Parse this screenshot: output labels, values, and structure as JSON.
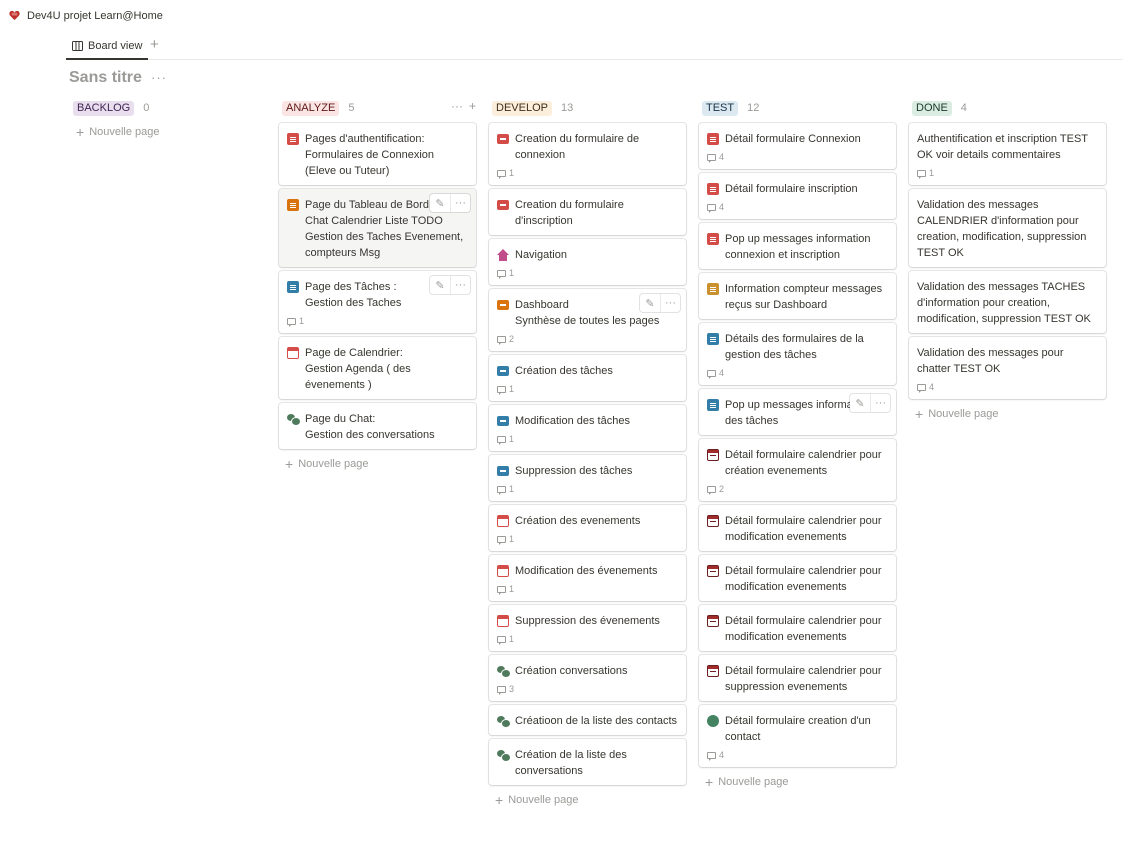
{
  "workspace": {
    "title": "Dev4U projet Learn@Home",
    "icon": "red-heart-icon"
  },
  "view": {
    "tab_label": "Board view",
    "add_icon": "plus-icon"
  },
  "database": {
    "title": "Sans titre",
    "more": "···"
  },
  "new_page_label": "Nouvelle page",
  "columns": [
    {
      "name": "BACKLOG",
      "count": "0",
      "bg": "#e8deee",
      "fg": "#412454",
      "cards": []
    },
    {
      "name": "ANALYZE",
      "count": "5",
      "bg": "#fbe4e4",
      "fg": "#5d1715",
      "actions": [
        "···",
        "+"
      ],
      "cards": [
        {
          "title": "Pages d'authentification:\nFormulaires de Connexion (Eleve ou Tuteur)",
          "icon": "ic-doc-red",
          "icon_name": "red-document-icon",
          "comments": ""
        },
        {
          "title": "Page du Tableau de Bord :\nChat Calendrier Liste TODO Gestion des Taches Evenement, compteurs Msg",
          "icon": "ic-doc-orange",
          "icon_name": "orange-document-icon",
          "comments": "",
          "hovered": true,
          "tools": true
        },
        {
          "title": "Page des Tâches :\nGestion des Taches",
          "icon": "ic-doc-blue",
          "icon_name": "blue-document-icon",
          "comments": "1",
          "tools": true
        },
        {
          "title": "Page de Calendrier:\nGestion Agenda ( des évenements )",
          "icon": "ic-cal-red",
          "icon_name": "calendar-icon",
          "comments": ""
        },
        {
          "title": "Page du Chat:\nGestion des conversations",
          "icon": "ic-chat-green",
          "icon_name": "chat-bubbles-icon",
          "comments": ""
        }
      ]
    },
    {
      "name": "DEVELOP",
      "count": "13",
      "bg": "#fbeeda",
      "fg": "#402c1b",
      "cards": [
        {
          "title": "Creation du formulaire de connexion",
          "icon": "ic-folder-red",
          "icon_name": "red-folder-icon",
          "comments": "1"
        },
        {
          "title": "Creation du formulaire d'inscription",
          "icon": "ic-folder-red",
          "icon_name": "red-folder-icon",
          "comments": ""
        },
        {
          "title": "Navigation",
          "icon": "ic-home",
          "icon_name": "home-icon",
          "comments": "1"
        },
        {
          "title": "Dashboard\nSynthèse de toutes les pages",
          "icon": "ic-folder-orange",
          "icon_name": "orange-folder-icon",
          "comments": "2",
          "tools": true
        },
        {
          "title": "Création des tâches",
          "icon": "ic-folder-blue",
          "icon_name": "blue-folder-icon",
          "comments": "1"
        },
        {
          "title": "Modification des tâches",
          "icon": "ic-folder-blue",
          "icon_name": "blue-folder-icon",
          "comments": "1"
        },
        {
          "title": "Suppression des tâches",
          "icon": "ic-folder-blue",
          "icon_name": "blue-folder-icon",
          "comments": "1"
        },
        {
          "title": "Création des evenements",
          "icon": "ic-cal-red",
          "icon_name": "calendar-icon",
          "comments": "1"
        },
        {
          "title": "Modification des évenements",
          "icon": "ic-cal-red",
          "icon_name": "calendar-icon",
          "comments": "1"
        },
        {
          "title": "Suppression des évenements",
          "icon": "ic-cal-red",
          "icon_name": "calendar-icon",
          "comments": "1"
        },
        {
          "title": "Création conversations",
          "icon": "ic-chat-green",
          "icon_name": "chat-bubbles-icon",
          "comments": "3"
        },
        {
          "title": "Créatioon de la liste des contacts",
          "icon": "ic-chat-green",
          "icon_name": "chat-bubbles-icon",
          "comments": ""
        },
        {
          "title": "Création de la liste des conversations",
          "icon": "ic-chat-green",
          "icon_name": "chat-bubbles-icon",
          "comments": ""
        }
      ]
    },
    {
      "name": "TEST",
      "count": "12",
      "bg": "#dde9f0",
      "fg": "#183347",
      "cards": [
        {
          "title": "Détail formulaire Connexion",
          "icon": "ic-doc-red",
          "icon_name": "red-document-icon",
          "comments": "4"
        },
        {
          "title": "Détail formulaire inscription",
          "icon": "ic-doc-red",
          "icon_name": "red-document-icon",
          "comments": "4"
        },
        {
          "title": "Pop up messages information connexion et inscription",
          "icon": "ic-doc-red",
          "icon_name": "red-document-icon",
          "comments": ""
        },
        {
          "title": "Information  compteur messages reçus sur Dashboard",
          "icon": "ic-doc-yellow",
          "icon_name": "yellow-document-icon",
          "comments": ""
        },
        {
          "title": "Détails des formulaires de la gestion des tâches",
          "icon": "ic-doc-blue",
          "icon_name": "blue-document-icon",
          "comments": "4"
        },
        {
          "title": "Pop up messages information des tâches",
          "icon": "ic-doc-blue",
          "icon_name": "blue-document-icon",
          "comments": "",
          "tools": true
        },
        {
          "title": "Détail  formulaire calendrier pour création evenements",
          "icon": "ic-cal-dark",
          "icon_name": "calendar-icon",
          "comments": "2"
        },
        {
          "title": "Détail  formulaire calendrier pour modification evenements",
          "icon": "ic-cal-dark",
          "icon_name": "calendar-icon",
          "comments": ""
        },
        {
          "title": "Détail  formulaire calendrier pour modification evenements",
          "icon": "ic-cal-dark",
          "icon_name": "calendar-icon",
          "comments": ""
        },
        {
          "title": "Détail  formulaire calendrier pour modification evenements",
          "icon": "ic-cal-dark",
          "icon_name": "calendar-icon",
          "comments": ""
        },
        {
          "title": "Détail  formulaire calendrier pour suppression evenements",
          "icon": "ic-cal-dark",
          "icon_name": "calendar-icon",
          "comments": ""
        },
        {
          "title": "Détail formulaire creation d'un contact",
          "icon": "ic-bubble-green",
          "icon_name": "green-speech-bubble-icon",
          "comments": "4"
        }
      ]
    },
    {
      "name": "DONE",
      "count": "4",
      "bg": "#dbede3",
      "fg": "#1c3829",
      "cards": [
        {
          "title": "Authentification et inscription   TEST OK voir details commentaires",
          "icon": "",
          "icon_name": "",
          "comments": "1"
        },
        {
          "title": "Validation des messages CALENDRIER d'information pour  creation, modification, suppression  TEST OK",
          "icon": "",
          "icon_name": "",
          "comments": ""
        },
        {
          "title": "Validation des messages TACHES d'information pour  creation, modification, suppression  TEST OK",
          "icon": "",
          "icon_name": "",
          "comments": ""
        },
        {
          "title": "Validation des messages pour chatter TEST  OK",
          "icon": "",
          "icon_name": "",
          "comments": "4"
        }
      ]
    }
  ]
}
